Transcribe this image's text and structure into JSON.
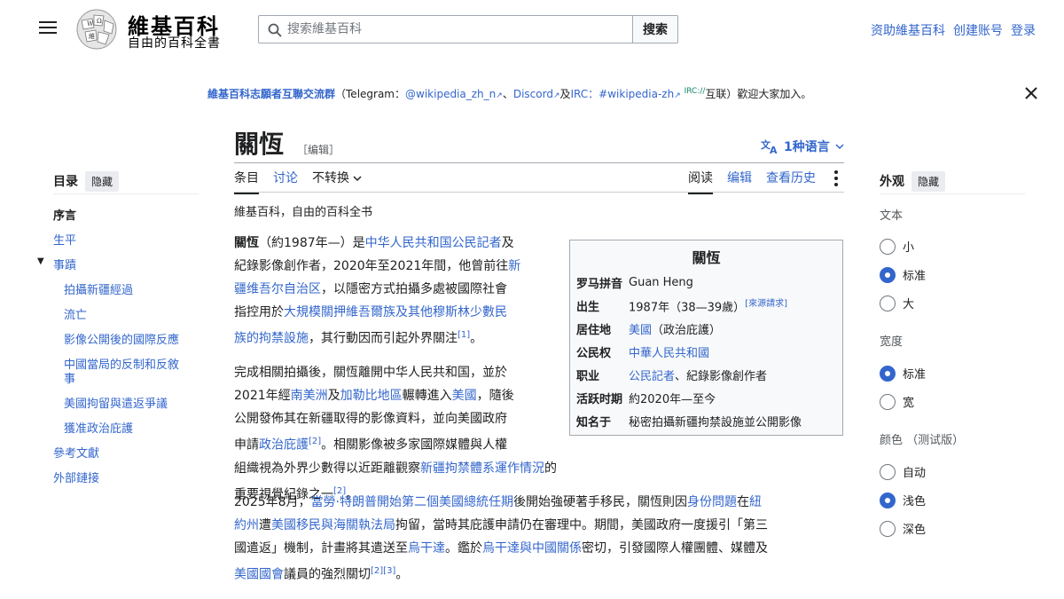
{
  "header": {
    "logo_title": "維基百科",
    "logo_tagline": "自由的百科全書",
    "search_placeholder": "搜索維基百科",
    "search_button": "搜索",
    "links": [
      "资助維基百科",
      "创建账号",
      "登录"
    ]
  },
  "banner": {
    "group_name": "維基百科志願者互聯交流群",
    "text_open": "（Telegram：",
    "telegram": "@wikipedia_zh_n",
    "sep1": "、",
    "discord": "Discord",
    "and": "及",
    "irc": "IRC：",
    "irc_channel": "#wikipedia-zh",
    "irc_sup": "IRC://",
    "text_close": "互联）歡迎大家加入。"
  },
  "page": {
    "title": "關恆",
    "edit_label": "［编辑］",
    "languages": "1种语言",
    "subtitle": "維基百科，自由的百科全书"
  },
  "tabs": {
    "left": [
      "条目",
      "讨论",
      "不转换"
    ],
    "right": [
      "阅读",
      "编辑",
      "查看历史"
    ]
  },
  "toc": {
    "heading": "目录",
    "hide": "隐藏",
    "items": [
      "序言",
      "生平",
      "事蹟",
      "拍攝新疆經過",
      "流亡",
      "影像公開後的國際反應",
      "中國當局的反制和反敘",
      "事",
      "美國拘留與遣返爭議",
      "獲准政治庇護",
      "參考文獻",
      "外部鏈接"
    ]
  },
  "appearance": {
    "heading": "外观",
    "hide": "隐藏",
    "text_label": "文本",
    "text_options": [
      "小",
      "标准",
      "大"
    ],
    "width_label": "宽度",
    "width_options": [
      "标准",
      "宽"
    ],
    "color_label": "颜色 （测试版）",
    "color_options": [
      "自动",
      "浅色",
      "深色"
    ],
    "accent": "#3366cc"
  },
  "infobox": {
    "title": "關恆",
    "rows": [
      {
        "k": "罗马拼音",
        "v": "Guan Heng"
      },
      {
        "k": "出生",
        "v": "1987年（38—39歲）",
        "sup": "[來源請求]"
      },
      {
        "k": "居住地",
        "v_link": "美國",
        "v": "（政治庇護）"
      },
      {
        "k": "公民权",
        "v_link": "中華人民共和國"
      },
      {
        "k": "职业",
        "v_link": "公民記者",
        "v": "、紀錄影像創作者"
      },
      {
        "k": "活跃时期",
        "v": "約2020年—至今"
      },
      {
        "k": "知名于",
        "v": "秘密拍攝新疆拘禁設施並公開影像"
      }
    ]
  },
  "paragraphs": {
    "p1": [
      {
        "t": "關恆",
        "b": true
      },
      {
        "t": "（約1987年—）是"
      },
      {
        "t": "中华人民共和国公民記者",
        "l": true
      },
      {
        "t": "及"
      },
      {
        "br": true
      },
      {
        "t": "紀錄影像創作者，2020年至2021年間，他曾前往"
      },
      {
        "t": "新",
        "l": true
      },
      {
        "br": true
      },
      {
        "t": "疆维吾尔自治区",
        "l": true
      },
      {
        "t": "，以隱密方式拍攝多處被國際社會"
      },
      {
        "br": true
      },
      {
        "t": "指控用於"
      },
      {
        "t": "大規模關押維吾爾族及其他穆斯林少數民",
        "l": true
      },
      {
        "br": true
      },
      {
        "t": "族的拘禁設施",
        "l": true
      },
      {
        "t": "，其行動因而引起外界關注"
      },
      {
        "t": "[1]",
        "s": true
      },
      {
        "t": "。"
      }
    ],
    "p2": [
      {
        "t": "完成相關拍攝後，關恆離開中华人民共和国，並於"
      },
      {
        "br": true
      },
      {
        "t": "2021年經"
      },
      {
        "t": "南美洲",
        "l": true
      },
      {
        "t": "及"
      },
      {
        "t": "加勒比地區",
        "l": true
      },
      {
        "t": "輾轉進入"
      },
      {
        "t": "美國",
        "l": true
      },
      {
        "t": "，隨後"
      },
      {
        "br": true
      },
      {
        "t": "公開發佈其在新疆取得的影像資料，並向美國政府"
      },
      {
        "br": true
      },
      {
        "t": "申請"
      },
      {
        "t": "政治庇護",
        "l": true
      },
      {
        "t": "[2]",
        "s": true
      },
      {
        "t": "。相關影像被多家國際媒體與人權"
      },
      {
        "br": true
      },
      {
        "t": "組織視為外界少數得以近距離觀察"
      },
      {
        "t": "新疆拘禁體系運作情況",
        "l": true
      },
      {
        "t": "的重要視覺紀錄之一"
      },
      {
        "t": "[2]",
        "s": true
      },
      {
        "t": "。"
      }
    ],
    "p3": [
      {
        "t": "2025年8月，"
      },
      {
        "t": "當勞·特朗普開始第二個美國總統任期",
        "l": true
      },
      {
        "t": "後開始強硬著手移民，關恆則因"
      },
      {
        "t": "身份問題",
        "l": true
      },
      {
        "t": "在"
      },
      {
        "t": "紐",
        "l": true
      },
      {
        "br": true
      },
      {
        "t": "約州",
        "l": true
      },
      {
        "t": "遭"
      },
      {
        "t": "美國移民與海關執法局",
        "l": true
      },
      {
        "t": "拘留，當時其庇護申請仍在審理中。期間，美國政府一度援引「第三"
      },
      {
        "br": true
      },
      {
        "t": "國遣返」機制，計畫將其遣送至"
      },
      {
        "t": "烏干達",
        "l": true
      },
      {
        "t": "。鑑於"
      },
      {
        "t": "烏干達與中國關係",
        "l": true
      },
      {
        "t": "密切，引發國際人權團體、媒體及"
      },
      {
        "br": true
      },
      {
        "t": "美國國會",
        "l": true
      },
      {
        "t": "議員的強烈關切"
      },
      {
        "t": "[2][3]",
        "s": true
      },
      {
        "t": "。"
      }
    ]
  }
}
